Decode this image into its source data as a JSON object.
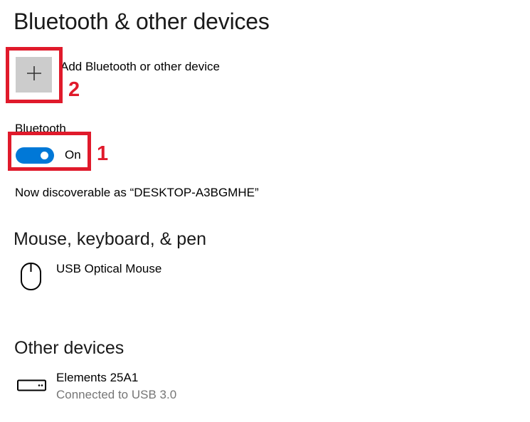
{
  "page": {
    "title": "Bluetooth & other devices"
  },
  "add_device": {
    "label": "Add Bluetooth or other device",
    "icon": "plus-icon"
  },
  "bluetooth": {
    "label": "Bluetooth",
    "state": "On",
    "enabled": true,
    "discoverable_text": "Now discoverable as “DESKTOP-A3BGMHE”"
  },
  "sections": {
    "mouse_keyboard_pen": {
      "heading": "Mouse, keyboard, & pen",
      "devices": [
        {
          "name": "USB Optical Mouse",
          "icon": "mouse-icon"
        }
      ]
    },
    "other_devices": {
      "heading": "Other devices",
      "devices": [
        {
          "name": "Elements 25A1",
          "status": "Connected to USB 3.0",
          "icon": "external-drive-icon"
        }
      ]
    }
  },
  "annotations": [
    {
      "number": "1",
      "target": "bluetooth-toggle"
    },
    {
      "number": "2",
      "target": "add-device-button"
    }
  ],
  "colors": {
    "accent": "#0078d7",
    "annotation": "#e01a2b",
    "tile": "#cccccc",
    "secondary_text": "#767676"
  }
}
